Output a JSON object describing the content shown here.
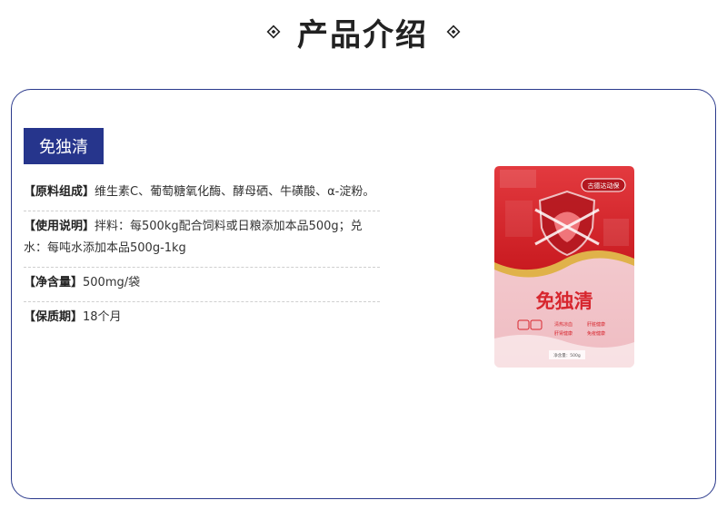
{
  "header": {
    "title": "产品介绍"
  },
  "product": {
    "tag": "免独清",
    "specs": [
      {
        "label": "【原料组成】",
        "value": "维生素C、葡萄糖氧化酶、酵母硒、牛磺酸、α-淀粉。"
      },
      {
        "label": "【使用说明】",
        "value": "拌料：每500kg配合饲料或日粮添加本品500g；兑水：每吨水添加本品500g-1kg"
      },
      {
        "label": "【净含量】",
        "value": "500mg/袋"
      },
      {
        "label": "【保质期】",
        "value": "18个月"
      }
    ],
    "package": {
      "brand": "古德达动保",
      "name": "免独清",
      "features": [
        "清热凉血",
        "肝脏健康",
        "肝肾健康",
        "免疫健康"
      ],
      "net_weight": "净含量：500g",
      "colors": {
        "red": "#d7262e",
        "pink": "#f3c7cc",
        "gold": "#e0b24a"
      }
    }
  },
  "colors": {
    "accent": "#26358c",
    "border": "#2b3a8c"
  }
}
